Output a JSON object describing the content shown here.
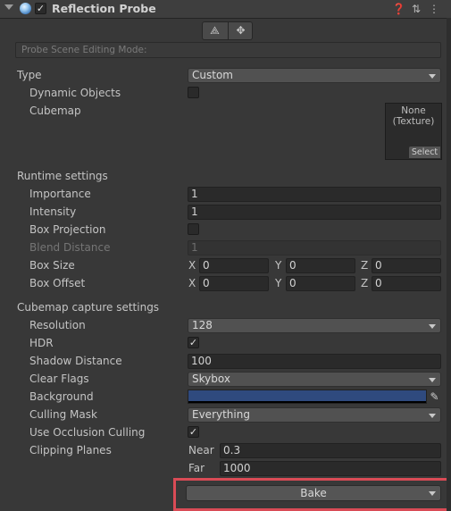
{
  "header": {
    "title": "Reflection Probe",
    "enabled": true,
    "icons": [
      "help-icon",
      "presets-icon",
      "more-menu-icon"
    ]
  },
  "edit_mode": {
    "placeholder": "Probe Scene Editing Mode:"
  },
  "type": {
    "label": "Type",
    "value": "Custom"
  },
  "dynamic_objects": {
    "label": "Dynamic Objects",
    "checked": false
  },
  "cubemap": {
    "label": "Cubemap",
    "value": "None\n(Texture)",
    "select": "Select"
  },
  "runtime": {
    "heading": "Runtime settings",
    "importance": {
      "label": "Importance",
      "value": "1"
    },
    "intensity": {
      "label": "Intensity",
      "value": "1"
    },
    "box_projection": {
      "label": "Box Projection",
      "checked": false
    },
    "blend_distance": {
      "label": "Blend Distance",
      "value": "1"
    },
    "box_size": {
      "label": "Box Size",
      "x": "0",
      "y": "0",
      "z": "0"
    },
    "box_offset": {
      "label": "Box Offset",
      "x": "0",
      "y": "0",
      "z": "0"
    },
    "axis": {
      "x": "X",
      "y": "Y",
      "z": "Z"
    }
  },
  "capture": {
    "heading": "Cubemap capture settings",
    "resolution": {
      "label": "Resolution",
      "value": "128"
    },
    "hdr": {
      "label": "HDR",
      "checked": true
    },
    "shadow_distance": {
      "label": "Shadow Distance",
      "value": "100"
    },
    "clear_flags": {
      "label": "Clear Flags",
      "value": "Skybox"
    },
    "background": {
      "label": "Background",
      "color": "#2f4a7e"
    },
    "culling_mask": {
      "label": "Culling Mask",
      "value": "Everything"
    },
    "occlusion": {
      "label": "Use Occlusion Culling",
      "checked": true
    },
    "clipping": {
      "label": "Clipping Planes",
      "near_label": "Near",
      "near": "0.3",
      "far_label": "Far",
      "far": "1000"
    }
  },
  "bake": {
    "label": "Bake"
  },
  "colors": {
    "highlight": "#d94b56",
    "panel": "#383838"
  }
}
